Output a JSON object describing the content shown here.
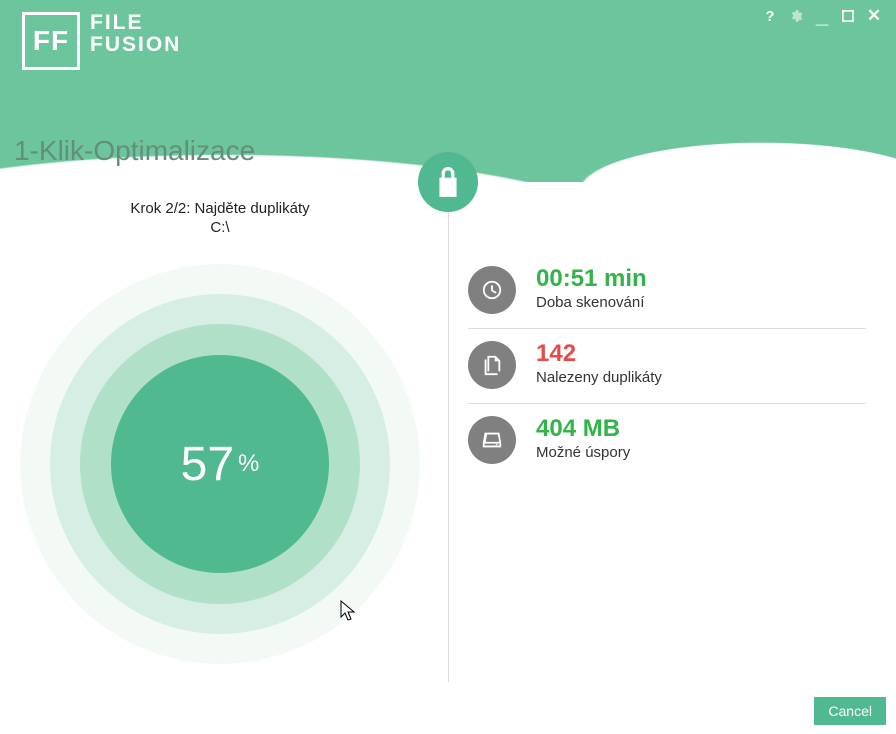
{
  "brand": {
    "short": "FF",
    "line1": "FILE",
    "line2": "FUSION"
  },
  "page_title": "1-Klik-Optimalizace",
  "step": {
    "label": "Krok 2/2: Najděte duplikáty",
    "path": "C:\\"
  },
  "progress": {
    "value": "57",
    "unit": "%"
  },
  "stats": {
    "time": {
      "value": "00:51 min",
      "label": "Doba skenování"
    },
    "dupes": {
      "value": "142",
      "label": "Nalezeny duplikáty"
    },
    "savings": {
      "value": "404 MB",
      "label": "Možné úspory"
    }
  },
  "footer": {
    "cancel": "Cancel"
  }
}
